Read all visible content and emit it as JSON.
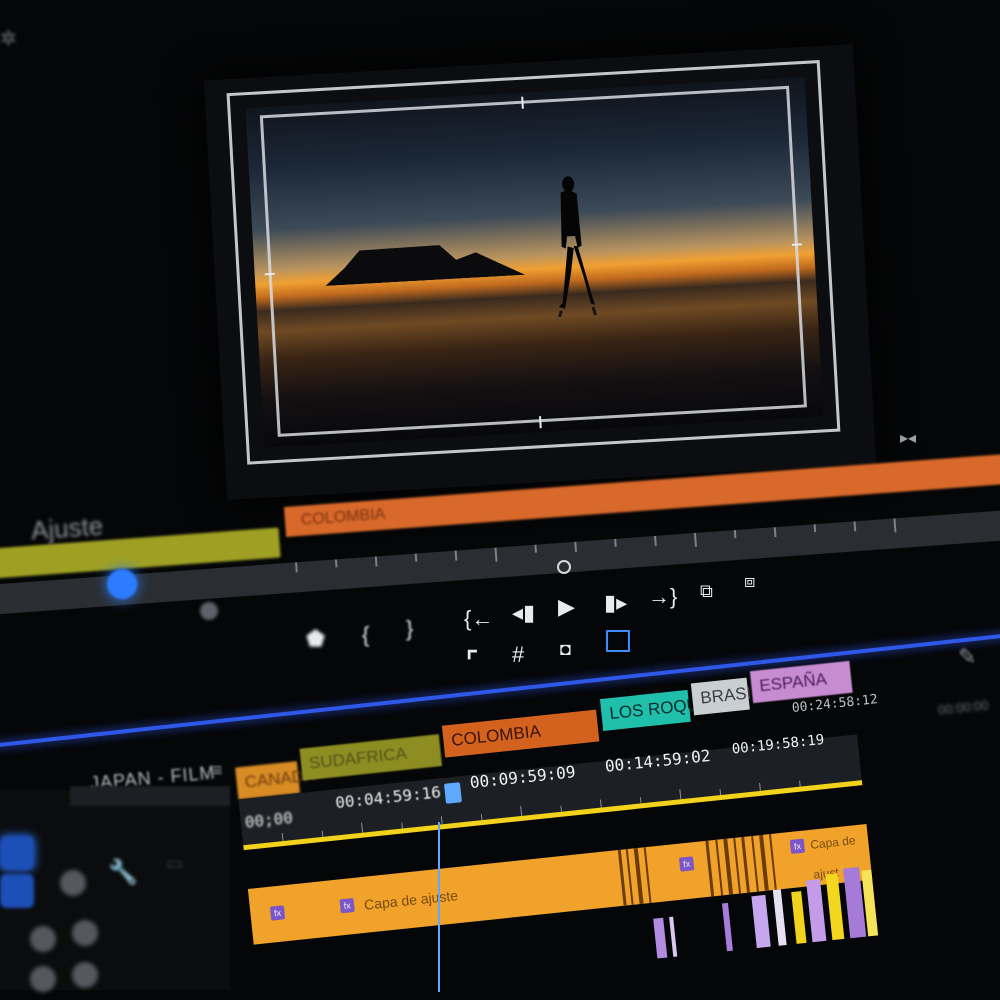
{
  "source_strip": {
    "label": "Ajuste",
    "clip_name": "COLOMBIA"
  },
  "transport": {
    "icons": [
      "marker-icon",
      "in-point-icon",
      "out-point-icon",
      "go-to-in-icon",
      "step-back-icon",
      "play-icon",
      "step-forward-icon",
      "go-to-out-icon",
      "insert-icon",
      "overwrite-icon",
      "lift-icon",
      "grid-icon",
      "camera-icon",
      "safe-margins-icon"
    ]
  },
  "sequence": {
    "tab_name": "JAPAN - FILM",
    "markers": [
      {
        "label": "CANADA",
        "color": "#d98c24"
      },
      {
        "label": "SUDAFRICA",
        "color": "#8d8d22"
      },
      {
        "label": "COLOMBIA",
        "color": "#d3621f"
      },
      {
        "label": "LOS ROQUES",
        "color": "#1fbfac"
      },
      {
        "label": "BRASIL",
        "color": "#c9ced2"
      },
      {
        "label": "ESPAÑA",
        "color": "#c78bd2"
      }
    ],
    "timecodes": [
      "00;00",
      "00:04:59:16",
      "00:09:59:09",
      "00:14:59:02",
      "00:19:58:19",
      "00:24:58:12"
    ],
    "adjustment_clip_1": "Capa de ajuste",
    "adjustment_clip_2": "Capa de ajust",
    "fx_badge": "fx",
    "right_timecode": "00:00:00"
  },
  "colors": {
    "accent": "#2d7cff",
    "orange_clip": "#f0a22a",
    "timeline_border": "#2f57e8"
  }
}
